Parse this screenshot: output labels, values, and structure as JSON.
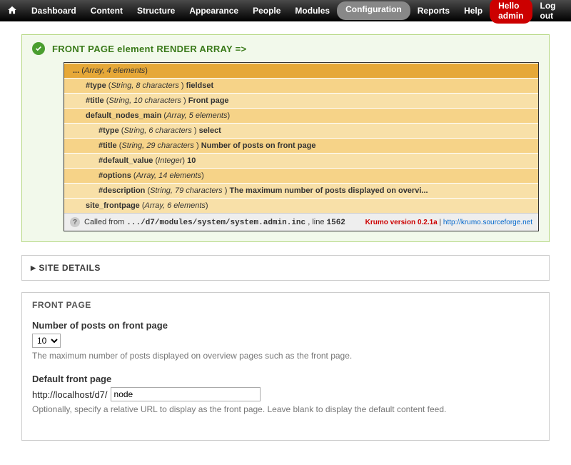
{
  "adminBar": {
    "items": [
      "Dashboard",
      "Content",
      "Structure",
      "Appearance",
      "People",
      "Modules",
      "Configuration",
      "Reports",
      "Help"
    ],
    "activeIndex": 6,
    "hello": "Hello admin",
    "logout": "Log out"
  },
  "status": {
    "title": "FRONT PAGE element RENDER ARRAY =>"
  },
  "krumo": {
    "rows": [
      {
        "depth": 0,
        "key": "...",
        "type": "Array, 4 elements",
        "value": ""
      },
      {
        "depth": 1,
        "key": "#type",
        "type": "String, 8 characters ",
        "value": "fieldset"
      },
      {
        "depth": 1,
        "key": "#title",
        "type": "String, 10 characters ",
        "value": "Front page",
        "alt": true
      },
      {
        "depth": 1,
        "key": "default_nodes_main",
        "type": "Array, 5 elements",
        "value": ""
      },
      {
        "depth": 2,
        "key": "#type",
        "type": "String, 6 characters ",
        "value": "select",
        "alt": true
      },
      {
        "depth": 2,
        "key": "#title",
        "type": "String, 29 characters ",
        "value": "Number of posts on front page"
      },
      {
        "depth": 2,
        "key": "#default_value",
        "type": "Integer",
        "value": "10",
        "alt": true
      },
      {
        "depth": 2,
        "key": "#options",
        "type": "Array, 14 elements",
        "value": ""
      },
      {
        "depth": 2,
        "key": "#description",
        "type": "String, 79 characters ",
        "value": "The maximum number of posts displayed on overvi...",
        "alt": true
      },
      {
        "depth": 1,
        "key": "site_frontpage",
        "type": "Array, 6 elements",
        "value": "",
        "alt": true
      }
    ],
    "footer": {
      "prefix": "Called from ",
      "path": ".../d7/modules/system/system.admin.inc",
      "lineLabel": ", line ",
      "line": "1562",
      "version": "Krumo version 0.2.1a",
      "sep": " | ",
      "link": "http://krumo.sourceforge.net"
    }
  },
  "siteDetails": {
    "title": "SITE DETAILS"
  },
  "frontPage": {
    "legend": "FRONT PAGE",
    "numPosts": {
      "label": "Number of posts on front page",
      "value": "10",
      "description": "The maximum number of posts displayed on overview pages such as the front page."
    },
    "defaultFront": {
      "label": "Default front page",
      "prefix": "http://localhost/d7/",
      "value": "node",
      "description": "Optionally, specify a relative URL to display as the front page. Leave blank to display the default content feed."
    }
  }
}
